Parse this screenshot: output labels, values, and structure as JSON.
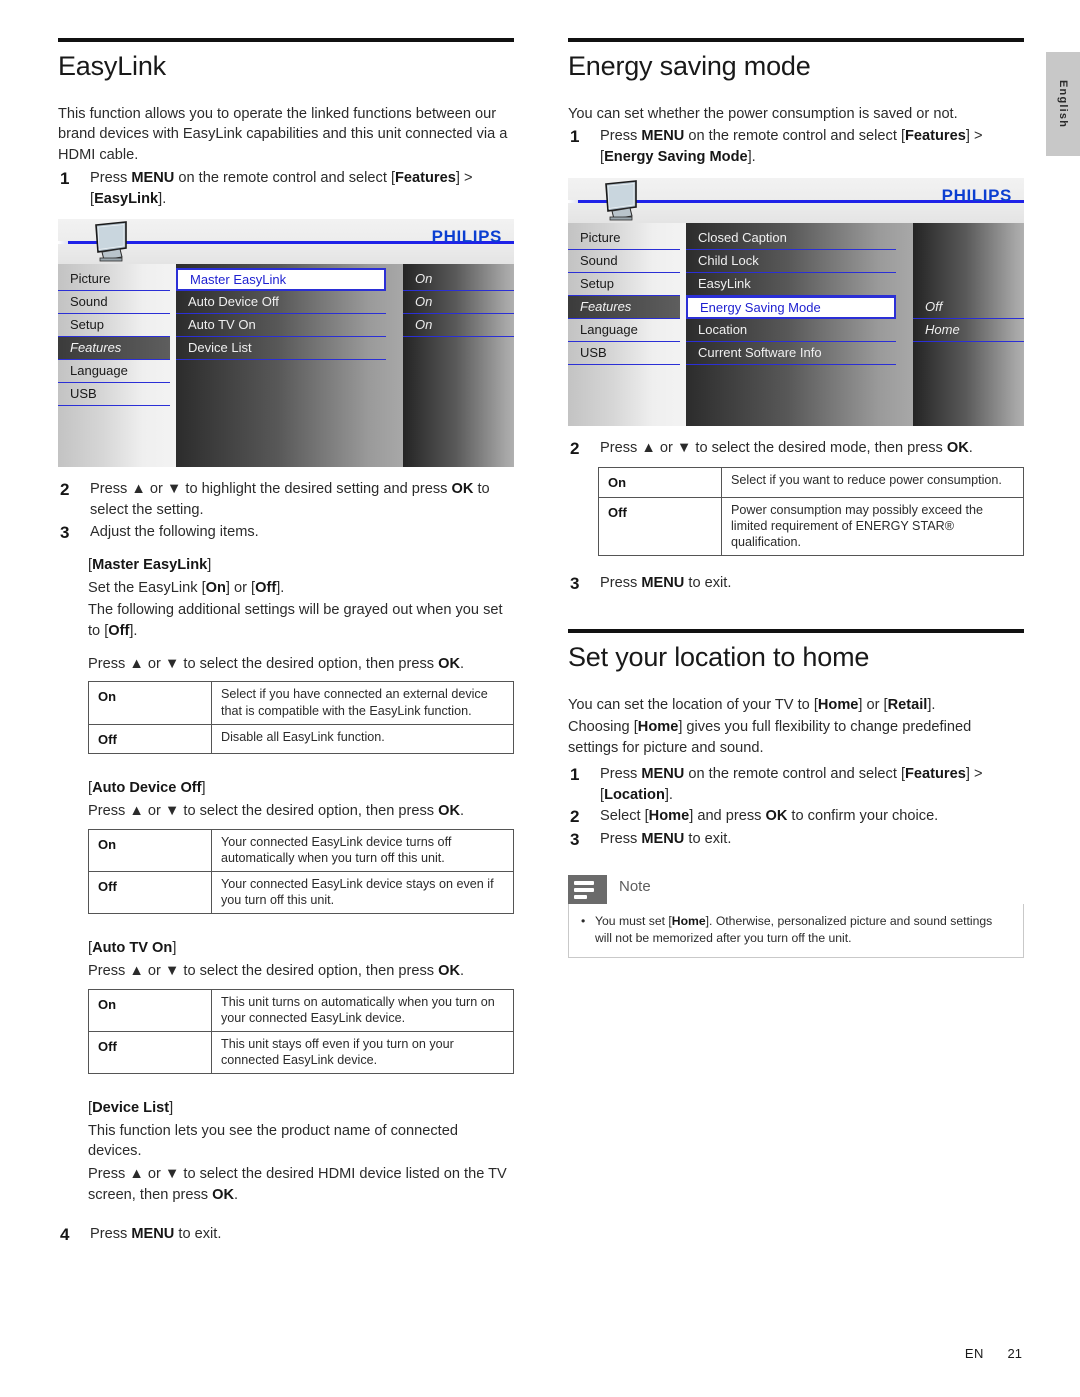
{
  "language_tab": "English",
  "footer": {
    "locale": "EN",
    "page": "21"
  },
  "left": {
    "heading": "EasyLink",
    "intro": "This function allows you to operate the linked functions between our brand devices with EasyLink capabilities and this unit connected via a HDMI cable.",
    "step1": {
      "num": "1",
      "text": "Press MENU on the remote control and select [Features] > [EasyLink]."
    },
    "menu": {
      "brand": "PHILIPS",
      "col1": [
        "Picture",
        "Sound",
        "Setup",
        "Features",
        "Language",
        "USB"
      ],
      "col1_selected": "Features",
      "col2": [
        "Master EasyLink",
        "Auto Device Off",
        "Auto TV On",
        "Device List"
      ],
      "col2_highlighted": "Master EasyLink",
      "col3": [
        "On",
        "On",
        "On",
        ""
      ]
    },
    "step2": {
      "num": "2",
      "text": "Press ▲ or ▼ to highlight the desired setting and press OK to select the setting."
    },
    "step3": {
      "num": "3",
      "text": "Adjust the following items."
    },
    "master": {
      "title": "[Master EasyLink]",
      "line1": "Set the EasyLink [On] or [Off].",
      "line2": "The following additional settings will be grayed out when you set to [Off].",
      "press": "Press ▲ or ▼ to select the desired option, then press OK.",
      "rows": [
        {
          "key": "On",
          "desc": "Select if you have connected an external device that is compatible with the EasyLink function."
        },
        {
          "key": "Off",
          "desc": "Disable all EasyLink function."
        }
      ]
    },
    "autodevice": {
      "title": "[Auto Device Off]",
      "press": "Press ▲ or ▼ to select the desired option, then press OK.",
      "rows": [
        {
          "key": "On",
          "desc": "Your connected EasyLink device turns off automatically when you turn off this unit."
        },
        {
          "key": "Off",
          "desc": "Your connected EasyLink device stays on even if you turn off this unit."
        }
      ]
    },
    "autotv": {
      "title": "[Auto TV On]",
      "press": "Press ▲ or ▼ to select the desired option, then press OK.",
      "rows": [
        {
          "key": "On",
          "desc": "This unit turns on automatically when you turn on your connected EasyLink device."
        },
        {
          "key": "Off",
          "desc": "This unit stays off even if you turn on your connected EasyLink device."
        }
      ]
    },
    "devicelist": {
      "title": "[Device List]",
      "line1": "This function lets you see the product name of connected devices.",
      "line2": "Press ▲ or ▼ to select the desired HDMI device listed on the TV screen, then press OK."
    },
    "step4": {
      "num": "4",
      "text": "Press MENU to exit."
    }
  },
  "right": {
    "energy": {
      "heading": "Energy saving mode",
      "intro": "You can set whether the power consumption is saved or not.",
      "step1": {
        "num": "1",
        "text": "Press MENU on the remote control and select [Features] > [Energy Saving Mode]."
      },
      "menu": {
        "brand": "PHILIPS",
        "col1": [
          "Picture",
          "Sound",
          "Setup",
          "Features",
          "Language",
          "USB"
        ],
        "col1_selected": "Features",
        "col2": [
          "Closed Caption",
          "Child Lock",
          "EasyLink",
          "Energy Saving Mode",
          "Location",
          "Current Software Info"
        ],
        "col2_highlighted": "Energy Saving Mode",
        "col3": [
          "",
          "",
          "",
          "Off",
          "Home",
          ""
        ]
      },
      "step2": {
        "num": "2",
        "text": "Press ▲ or ▼ to select the desired mode, then press OK."
      },
      "rows": [
        {
          "key": "On",
          "desc": "Select if you want to reduce power consumption."
        },
        {
          "key": "Off",
          "desc": "Power consumption may possibly exceed the limited requirement of ENERGY STAR® qualification."
        }
      ],
      "step3": {
        "num": "3",
        "text": "Press MENU to exit."
      }
    },
    "location": {
      "heading": "Set your location to home",
      "intro1": "You can set the location of your TV to [Home] or [Retail].",
      "intro2": "Choosing [Home] gives you full flexibility to change predefined settings for picture and sound.",
      "step1": {
        "num": "1",
        "text": "Press MENU on the remote control and select [Features] > [Location]."
      },
      "step2": {
        "num": "2",
        "text": "Select [Home] and press OK to confirm your choice."
      },
      "step3": {
        "num": "3",
        "text": "Press MENU to exit."
      }
    },
    "note": {
      "title": "Note",
      "bullet": "•",
      "text": "You must set [Home]. Otherwise, personalized picture and sound settings will not be memorized after you turn off the unit."
    }
  }
}
